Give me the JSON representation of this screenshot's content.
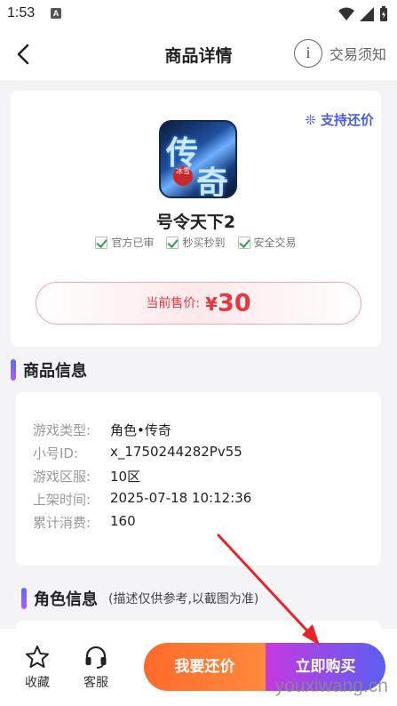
{
  "status": {
    "time": "1:53",
    "notif": "A"
  },
  "nav": {
    "title": "商品详情",
    "notice_icon": "i",
    "notice_label": "交易须知"
  },
  "product": {
    "support_label": "❊ 支持还价",
    "game_name": "号令天下2",
    "icon_text_1": "传",
    "icon_text_2": "奇",
    "icon_seal": "冰雪",
    "badges": [
      "官方已审",
      "秒买秒到",
      "安全交易"
    ],
    "price_label": "当前售价:",
    "currency": "¥",
    "price": "30"
  },
  "info": {
    "section_title": "商品信息",
    "rows": [
      {
        "key": "游戏类型:",
        "value": "角色•传奇"
      },
      {
        "key": "小号ID:",
        "value": "x_1750244282Pv55"
      },
      {
        "key": "游戏区服:",
        "value": "10区"
      },
      {
        "key": "上架时间:",
        "value": "2025-07-18 10:12:36"
      },
      {
        "key": "累计消费:",
        "value": "160"
      }
    ]
  },
  "role": {
    "section_title": "角色信息",
    "sub": "(描述仅供参考,以截图为准)"
  },
  "bottom": {
    "favorite": "收藏",
    "service": "客服",
    "bargain": "我要还价",
    "buy": "立即购买"
  },
  "watermark": "youxiwang.cn",
  "colors": {
    "accent": "#4a5de8",
    "price": "#e8363f",
    "bargain": "#ff6a2b",
    "buy": "#5b5ff0"
  }
}
